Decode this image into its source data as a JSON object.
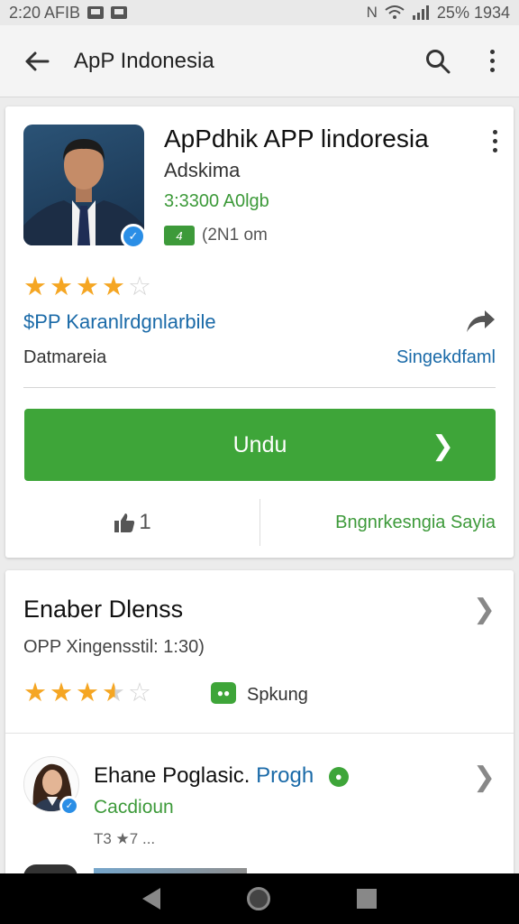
{
  "status_bar": {
    "time": "2:20 AFIB",
    "right_text": "25% 1934",
    "icons": [
      "notification-icon",
      "notification-icon",
      "nfc-icon",
      "wifi-icon",
      "signal-icon",
      "battery-icon"
    ]
  },
  "app_bar": {
    "title": "ApP Indonesia",
    "back_icon": "arrow-left-icon",
    "search_icon": "search-icon",
    "more_icon": "more-vertical-icon"
  },
  "app": {
    "name": "ApPdhik APP lindoresia",
    "developer": "Adskima",
    "price": "3:3300 A0lgb",
    "size": "(2N1 om",
    "size_badge": "4",
    "rating_stars": 4,
    "category": "$PP Karanlrdgnlarbile",
    "content_rating": "Datmareia",
    "similar_link": "Singekdfaml",
    "install_label": "Undu",
    "likes": "1",
    "feedback_link": "Bngnrkesngia Sayia",
    "colors": {
      "accent": "#3ea539",
      "link": "#1a6aa8",
      "star": "#f5a623"
    }
  },
  "review": {
    "title": "Enaber Dlenss",
    "version": "OPP Xingensstil: 1:30)",
    "rating_stars": 3.5,
    "chat_label": "Spkung",
    "reviewer": {
      "name": "Ehane Poglasic.",
      "tag": "Progh",
      "subtitle": "Cacdioun",
      "meta": "T3 ★7 ..."
    }
  },
  "nav_bar": {
    "icons": [
      "nav-back-icon",
      "nav-home-icon",
      "nav-recents-icon"
    ]
  }
}
